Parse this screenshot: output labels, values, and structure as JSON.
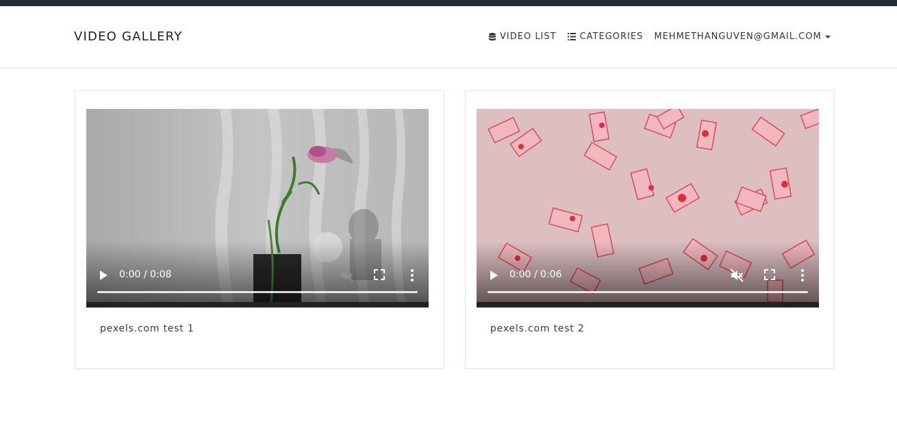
{
  "app": {
    "title": "VIDEO GALLERY"
  },
  "nav": {
    "video_list": "VIDEO LIST",
    "categories": "CATEGORIES",
    "user_email": "MEHMETHANGUVEN@GMAIL.COM"
  },
  "colors": {
    "topbar": "#222b33",
    "card_border": "#e2e2e2",
    "video1_bg": "#bdbdbd",
    "video2_bg": "#ddbfc2"
  },
  "videos": [
    {
      "time": "0:00 / 0:08",
      "title": "pexels.com test 1"
    },
    {
      "time": "0:00 / 0:06",
      "title": "pexels.com test 2"
    }
  ]
}
